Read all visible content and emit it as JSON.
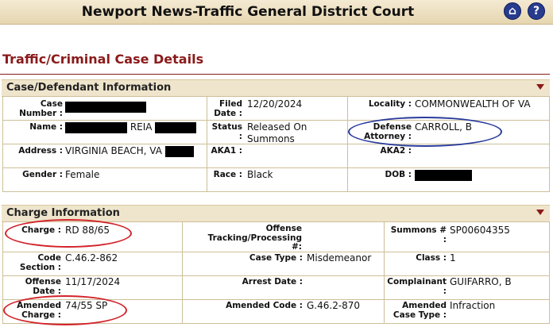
{
  "header": {
    "title": "Newport News-Traffic General District Court"
  },
  "page": {
    "title": "Traffic/Criminal Case Details"
  },
  "case_section": {
    "title": "Case/Defendant Information",
    "case_number_label": "Case Number :",
    "filed_date_label": "Filed Date :",
    "filed_date": "12/20/2024",
    "locality_label": "Locality :",
    "locality": "COMMONWEALTH OF VA",
    "name_label": "Name :",
    "name_visible": "REIA",
    "status_label": "Status :",
    "status": "Released On Summons",
    "defense_attorney_label": "Defense Attorney :",
    "defense_attorney": "CARROLL, B",
    "address_label": "Address :",
    "address": "VIRGINIA BEACH, VA",
    "aka1_label": "AKA1 :",
    "aka1": "",
    "aka2_label": "AKA2 :",
    "aka2": "",
    "gender_label": "Gender :",
    "gender": "Female",
    "race_label": "Race :",
    "race": "Black",
    "dob_label": "DOB :"
  },
  "charge_section": {
    "title": "Charge Information",
    "charge_label": "Charge :",
    "charge": "RD 88/65",
    "offense_tracking_label": "Offense Tracking/Processing #:",
    "offense_tracking": "",
    "summons_label": "Summons # :",
    "summons": "SP00604355",
    "code_section_label": "Code Section :",
    "code_section": "C.46.2-862",
    "case_type_label": "Case Type :",
    "case_type": "Misdemeanor",
    "class_label": "Class :",
    "class": "1",
    "offense_date_label": "Offense Date :",
    "offense_date": "11/17/2024",
    "arrest_date_label": "Arrest Date :",
    "arrest_date": "",
    "complainant_label": "Complainant :",
    "complainant": "GUIFARRO, B",
    "amended_charge_label": "Amended Charge :",
    "amended_charge": "74/55 SP",
    "amended_code_label": "Amended Code :",
    "amended_code": "G.46.2-870",
    "amended_case_type_label": "Amended Case Type :",
    "amended_case_type": "Infraction"
  },
  "icons": {
    "home": "home-icon",
    "help": "help-icon"
  },
  "colors": {
    "accent": "#8b1a1a",
    "header_bg": "#efe5cc",
    "annotation_red": "#d2232a",
    "annotation_blue": "#2a3c9c"
  }
}
